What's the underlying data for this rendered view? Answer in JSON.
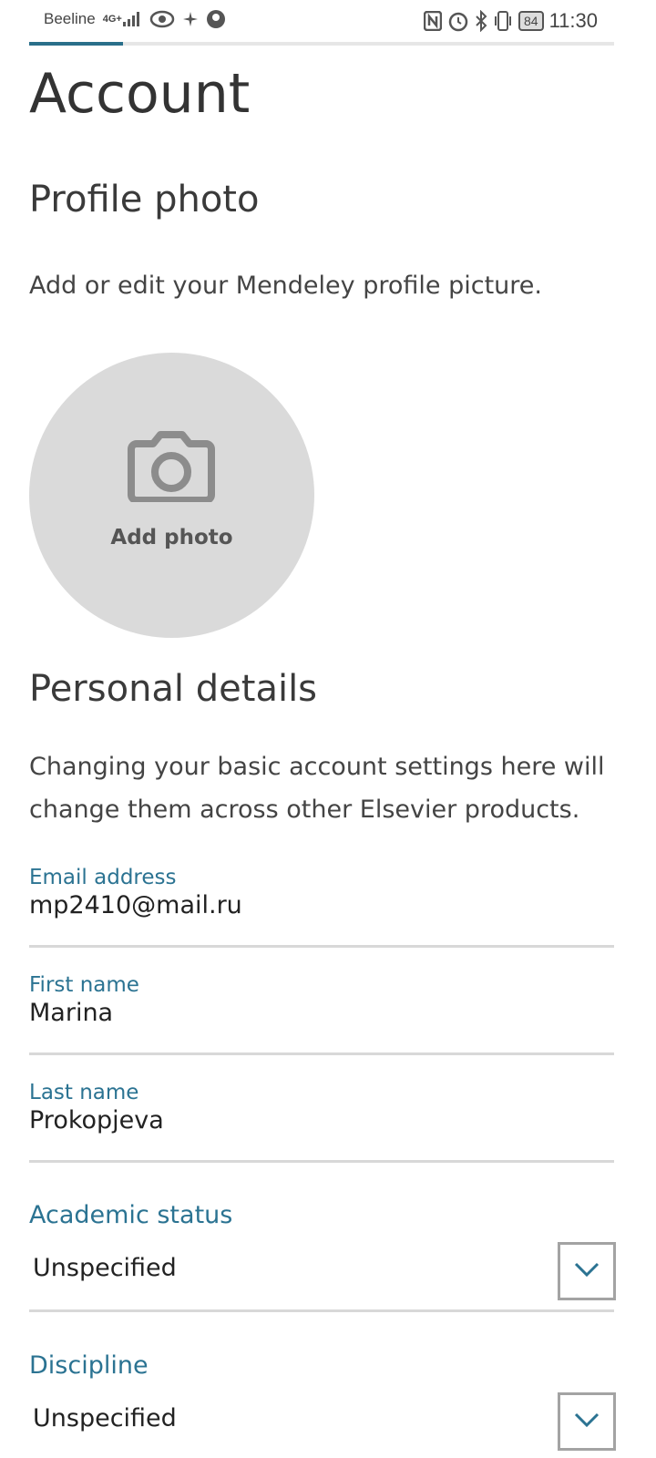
{
  "status_bar": {
    "carrier": "Beeline",
    "network": "4G+",
    "battery": "84",
    "time": "11:30"
  },
  "colors": {
    "accent": "#2b7392",
    "progress": "#2a6f8a",
    "avatar_bg": "#dadada",
    "divider": "#d8d8d8"
  },
  "page_progress": 0.16,
  "page": {
    "title": "Account"
  },
  "profile_photo": {
    "heading": "Profile photo",
    "description": "Add or edit your Mendeley profile picture.",
    "add_photo_label": "Add photo",
    "icon": "camera-icon"
  },
  "personal_details": {
    "heading": "Personal details",
    "description": "Changing your basic account settings here will change them across other Elsevier products.",
    "fields": [
      {
        "label": "Email address",
        "value": "mp2410@mail.ru"
      },
      {
        "label": "First name",
        "value": "Marina"
      },
      {
        "label": "Last name",
        "value": "Prokopjeva"
      }
    ],
    "selects": [
      {
        "label": "Academic status",
        "value": "Unspecified",
        "icon": "chevron-down-icon"
      },
      {
        "label": "Discipline",
        "value": "Unspecified",
        "icon": "chevron-down-icon"
      }
    ]
  }
}
